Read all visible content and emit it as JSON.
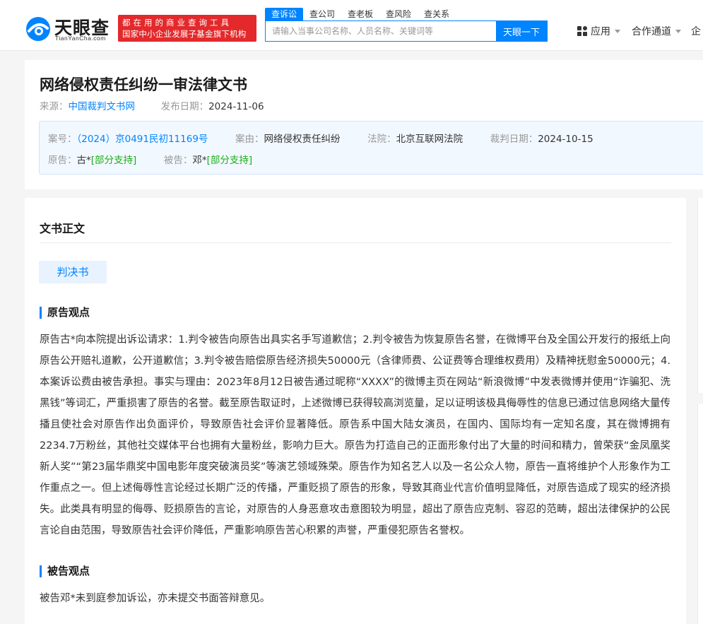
{
  "header": {
    "logo": {
      "cn": "天眼查",
      "en": "TianYanCha.com"
    },
    "slogan": {
      "line1": "都在用的商业查询工具",
      "line2": "国家中小企业发展子基金旗下机构"
    },
    "search_tabs": [
      "查诉讼",
      "查公司",
      "查老板",
      "查风险",
      "查关系"
    ],
    "search": {
      "placeholder": "请输入当事公司名称、人员名称、关键词等",
      "button": "天眼一下"
    },
    "nav": {
      "apps": "应用",
      "channel": "合作通道",
      "partial": "企"
    }
  },
  "document": {
    "title": "网络侵权责任纠纷一审法律文书",
    "source_label": "来源：",
    "source": "中国裁判文书网",
    "publish_label": "发布日期：",
    "publish_date": "2024-11-06",
    "case_no_label": "案号：",
    "case_no": "（2024）京0491民初11169号",
    "cause_label": "案由：",
    "cause": "网络侵权责任纠纷",
    "court_label": "法院：",
    "court": "北京互联网法院",
    "judge_date_label": "裁判日期：",
    "judge_date": "2024-10-15",
    "plaintiff_label": "原告：",
    "plaintiff": "古*",
    "plaintiff_status": "[部分支持]",
    "defendant_label": "被告：",
    "defendant": "邓*",
    "defendant_status": "[部分支持]"
  },
  "body": {
    "section_title": "文书正文",
    "doc_type": "判决书",
    "plaintiff_head": "原告观点",
    "plaintiff_text": "原告古*向本院提出诉讼请求：1.判令被告向原告出具实名手写道歉信；2.判令被告为恢复原告名誉，在微博平台及全国公开发行的报纸上向原告公开赔礼道歉，公开道歉信；3.判令被告赔偿原告经济损失50000元（含律师费、公证费等合理维权费用）及精神抚慰金50000元；4.本案诉讼费由被告承担。事实与理由：2023年8月12日被告通过昵称“XXXX”的微博主页在网站“新浪微博”中发表微博并使用“诈骗犯、洗黑钱”等词汇，严重损害了原告的名誉。截至原告取证时，上述微博已获得较高浏览量，足以证明该极具侮辱性的信息已通过信息网络大量传播且使社会对原告作出负面评价，导致原告社会评价显著降低。原告系中国大陆女演员，在国内、国际均有一定知名度，其在微博拥有2234.7万粉丝，其他社交媒体平台也拥有大量粉丝，影响力巨大。原告为打造自己的正面形象付出了大量的时间和精力，曾荣获“金凤凰奖新人奖”“第23届华鼎奖中国电影年度突破演员奖”等演艺领域殊荣。原告作为知名艺人以及一名公众人物，原告一直将维护个人形象作为工作重点之一。但上述侮辱性言论经过长期广泛的传播，严重贬损了原告的形象，导致其商业代言价值明显降低，对原告造成了现实的经济损失。此类具有明显的侮辱、贬损原告的言论，对原告的人身恶意攻击意图较为明显，超出了原告应克制、容忍的范畴，超出法律保护的公民言论自由范围，导致原告社会评价降低，严重影响原告苦心积累的声誉，严重侵犯原告名誉权。",
    "defendant_head": "被告观点",
    "defendant_text": "被告邓*未到庭参加诉讼，亦未提交书面答辩意见。"
  },
  "colors": {
    "brand_blue": "#0084ff",
    "slogan_red": "#e3292b",
    "support_green": "#1aad19"
  }
}
